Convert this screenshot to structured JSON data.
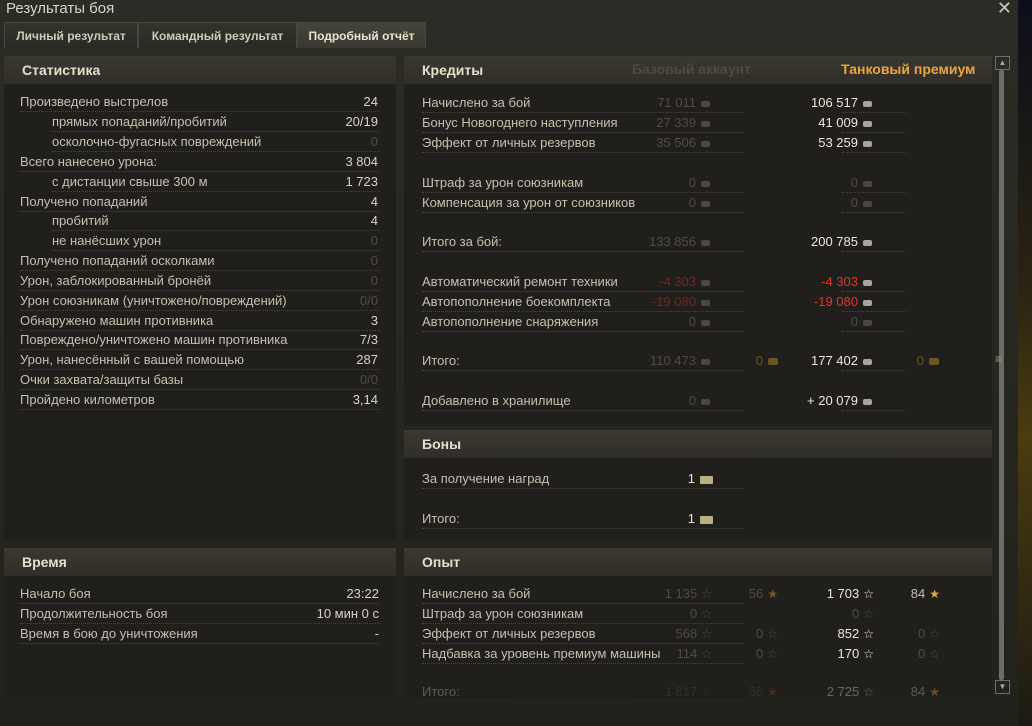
{
  "window": {
    "title": "Результаты боя",
    "close_symbol": "✕"
  },
  "tabs": [
    {
      "label": "Личный результат"
    },
    {
      "label": "Командный результат"
    },
    {
      "label": "Подробный отчёт"
    }
  ],
  "stats": {
    "header": "Статистика",
    "rows": [
      {
        "label": "Произведено выстрелов",
        "value": "24"
      },
      {
        "label": "прямых попаданий/пробитий",
        "value": "20/19"
      },
      {
        "label": "осколочно-фугасных повреждений",
        "value": "0"
      },
      {
        "label": "Всего нанесено урона:",
        "value": "3 804"
      },
      {
        "label": "с дистанции свыше 300 м",
        "value": "1 723"
      },
      {
        "label": "Получено попаданий",
        "value": "4"
      },
      {
        "label": "пробитий",
        "value": "4"
      },
      {
        "label": "не нанёсших урон",
        "value": "0"
      },
      {
        "label": "Получено попаданий осколками",
        "value": "0"
      },
      {
        "label": "Урон, заблокированный бронёй",
        "value": "0"
      },
      {
        "label": "Урон союзникам (уничтожено/повреждений)",
        "value": "0/0"
      },
      {
        "label": "Обнаружено машин противника",
        "value": "3"
      },
      {
        "label": "Повреждено/уничтожено машин противника",
        "value": "7/3"
      },
      {
        "label": "Урон, нанесённый с вашей помощью",
        "value": "287"
      },
      {
        "label": "Очки захвата/защиты базы",
        "value": "0/0"
      },
      {
        "label": "Пройдено километров",
        "value": "3,14"
      }
    ]
  },
  "time": {
    "header": "Время",
    "rows": [
      {
        "label": "Начало боя",
        "value": "23:22"
      },
      {
        "label": "Продолжительность боя",
        "value": "10 мин 0 с"
      },
      {
        "label": "Время в бою до уничтожения",
        "value": "-"
      }
    ]
  },
  "credits": {
    "header": "Кредиты",
    "col_base": "Базовый аккаунт",
    "col_premium": "Танковый премиум",
    "rows": [
      {
        "label": "Начислено за бой",
        "base": "71 011",
        "prem": "106 517"
      },
      {
        "label": "Бонус Новогоднего наступления",
        "base": "27 339",
        "prem": "41 009"
      },
      {
        "label": "Эффект от личных резервов",
        "base": "35 506",
        "prem": "53 259"
      },
      {
        "label": "Штраф за урон союзникам",
        "base": "0",
        "prem": "0"
      },
      {
        "label": "Компенсация за урон от союзников",
        "base": "0",
        "prem": "0"
      },
      {
        "label": "Итого за бой:",
        "base": "133 856",
        "prem": "200 785"
      },
      {
        "label": "Автоматический ремонт техники",
        "base": "-4 303",
        "prem": "-4 303"
      },
      {
        "label": "Автопополнение боекомплекта",
        "base": "-19 080",
        "prem": "-19 080"
      },
      {
        "label": "Автопополнение снаряжения",
        "base": "0",
        "prem": "0"
      },
      {
        "label": "Итого:",
        "base": "110 473",
        "base_gold": "0",
        "prem": "177 402",
        "prem_gold": "0"
      },
      {
        "label": "Добавлено в хранилище",
        "base": "0",
        "prem": "+ 20 079"
      }
    ]
  },
  "bonds": {
    "header": "Боны",
    "rows": [
      {
        "label": "За получение наград",
        "value": "1"
      },
      {
        "label": "Итого:",
        "value": "1"
      }
    ]
  },
  "xp": {
    "header": "Опыт",
    "rows": [
      {
        "label": "Начислено за бой",
        "base": "1 135",
        "base_free": "56",
        "prem": "1 703",
        "prem_free": "84"
      },
      {
        "label": "Штраф за урон союзникам",
        "base": "0",
        "prem": "0"
      },
      {
        "label": "Эффект от личных резервов",
        "base": "568",
        "base_free": "0",
        "prem": "852",
        "prem_free": "0"
      },
      {
        "label": "Надбавка за уровень премиум машины",
        "base": "114",
        "base_free": "0",
        "prem": "170",
        "prem_free": "0"
      },
      {
        "label": "Итого:",
        "base": "1 817",
        "base_free": "56",
        "prem": "2 725",
        "prem_free": "84"
      }
    ]
  },
  "scrollbar": {
    "up": "▲",
    "grip": "≡",
    "down": "▼"
  },
  "colors": {
    "premium_header": "#e9a640",
    "negative": "#e03528"
  }
}
